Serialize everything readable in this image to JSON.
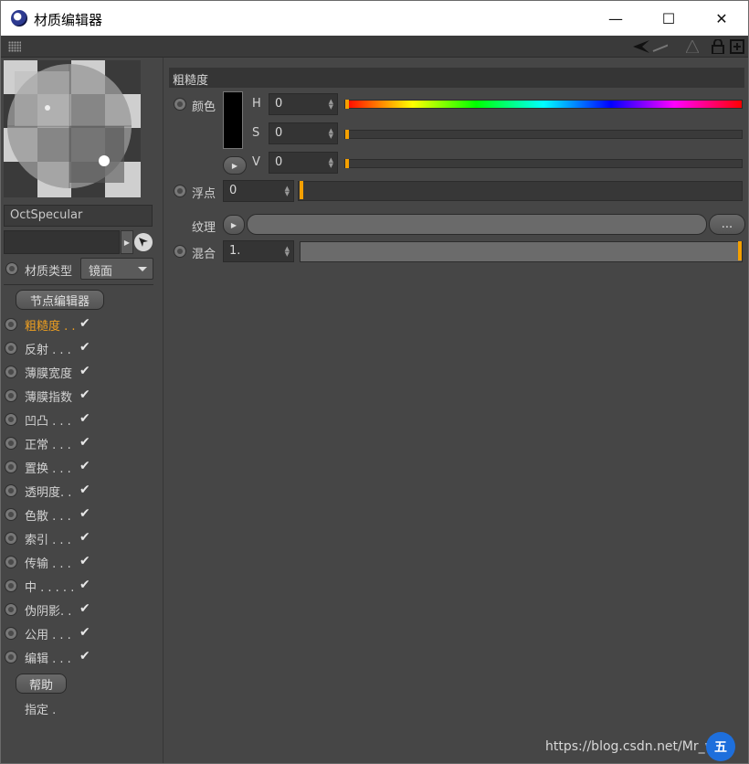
{
  "window": {
    "title": "材质编辑器",
    "minimize": "—",
    "maximize": "☐",
    "close": "✕"
  },
  "toolbar": {
    "icons": [
      "grip-icon",
      "back-arrow-icon",
      "forward-arrow-icon",
      "up-arrow-icon",
      "lock-icon",
      "new-window-icon"
    ]
  },
  "left": {
    "material_name": "OctSpecular",
    "material_type_label": "材质类型",
    "material_type_value": "镜面",
    "node_editor_button": "节点编辑器",
    "channels": [
      {
        "label": "粗糙度 . .",
        "checked": true,
        "active": true
      },
      {
        "label": "反射 . . .",
        "checked": true
      },
      {
        "label": "薄膜宽度",
        "checked": true
      },
      {
        "label": "薄膜指数",
        "checked": true
      },
      {
        "label": "凹凸 . . .",
        "checked": true
      },
      {
        "label": "正常 . . .",
        "checked": true
      },
      {
        "label": "置换 . . .",
        "checked": true
      },
      {
        "label": "透明度. .",
        "checked": true
      },
      {
        "label": "色散 . . .",
        "checked": true
      },
      {
        "label": "索引 . . .",
        "checked": true
      },
      {
        "label": "传输 . . .",
        "checked": true
      },
      {
        "label": "中 . . . . .",
        "checked": true
      },
      {
        "label": "伪阴影. .",
        "checked": true
      },
      {
        "label": "公用 . . .",
        "checked": true
      },
      {
        "label": "编辑 . . .",
        "checked": true
      }
    ],
    "check_glyph": "✔",
    "help_button": "帮助",
    "assign_label": "指定 ."
  },
  "right": {
    "section_title": "粗糙度",
    "color_label": "颜色",
    "h_label": "H",
    "h_value": "0",
    "s_label": "S",
    "s_value": "0",
    "v_label": "V",
    "v_value": "0",
    "float_label": "浮点",
    "float_value": "0",
    "texture_label": "纹理",
    "texture_more": "...",
    "mix_label": "混合",
    "mix_value": "1."
  },
  "watermark": "https://blog.csdn.net/Mr_w",
  "watermark_badge": "五"
}
